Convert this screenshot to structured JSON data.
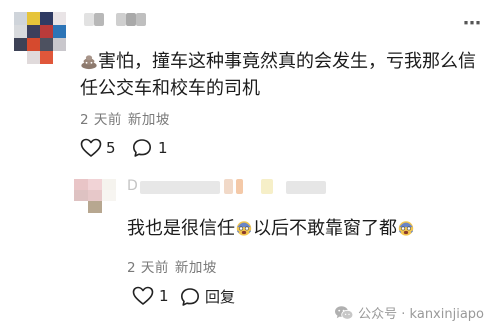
{
  "comment1": {
    "text": "害怕，撞车这种事竟然真的会发生，亏我那么信任公交车和校车的司机",
    "time": "2 天前",
    "location": "新加坡",
    "like_count": "5",
    "reply_count": "1"
  },
  "reply1": {
    "author_fragment": "D",
    "text_part1": "我也是很信任",
    "text_part2": "以后不敢靠窗了都",
    "time": "2 天前",
    "location": "新加坡",
    "like_count": "1",
    "reply_label": "回复"
  },
  "watermark": {
    "text": "公众号 · kanxinjiapo"
  },
  "icons": {
    "more": "more-dots-icon",
    "like": "heart-icon",
    "comment": "comment-bubble-icon",
    "emoji": "scared-face-emoji-icon",
    "poop": "poop-emoji-icon",
    "wechat": "wechat-logo-icon"
  },
  "colors": {
    "text": "#1c1c1c",
    "meta": "#7a7a7a",
    "watermark": "#9a9a9a"
  }
}
